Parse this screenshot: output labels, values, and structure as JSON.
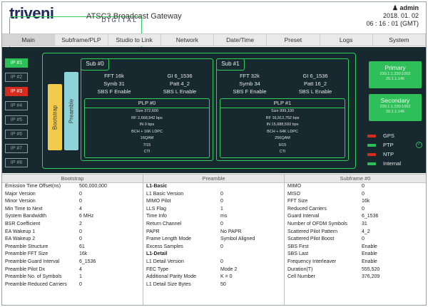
{
  "header": {
    "logo_word": "triveni",
    "logo_sub": "DIGITAL",
    "title": "ATSC3 Broadcast Gateway",
    "user": "admin",
    "date": "2018. 01. 02",
    "time": "06 : 16 : 01 (GMT)"
  },
  "nav": [
    "Main",
    "Subframe/PLP",
    "Studio to Link",
    "Network",
    "Date/Time",
    "Preset",
    "Logs",
    "System"
  ],
  "ip_inputs": [
    "IP #1",
    "IP #2",
    "IP #3",
    "IP #4",
    "IP #5",
    "IP #6",
    "IP #7",
    "IP #8"
  ],
  "ip_states": [
    "green",
    "grey",
    "red",
    "grey",
    "grey",
    "grey",
    "grey",
    "grey"
  ],
  "bars": {
    "bootstrap": "Bootstrap",
    "preamble": "Preamble"
  },
  "subframes": [
    {
      "label": "Sub #0",
      "fft": "FFT 16k",
      "gi": "GI 6_1536",
      "symb": "Symb 31",
      "patt": "Patt 4_2",
      "sbs": "SBS F Enable",
      "sbs2": "SBS L Enable",
      "plp": {
        "label": "PLP #0",
        "lines": [
          "Size 372,600",
          "RF 2,668,942 bps",
          "IN 0 bps",
          "BCH + 16K LDPC",
          "16QAM",
          "7/15",
          "CTI"
        ]
      }
    },
    {
      "label": "Sub #1",
      "fft": "FFT 32k",
      "gi": "GI 6_1536",
      "symb": "Symb 34",
      "patt": "Patt 16_2",
      "sbs": "SBS F Enable",
      "sbs2": "SBS L Enable",
      "plp": {
        "label": "PLP #1",
        "lines": [
          "Size 999,100",
          "RF 16,912,752 bps",
          "IN 15,688,593 bps",
          "BCH + 64K LDPC",
          "256QAM",
          "9/15",
          "CTI"
        ]
      }
    }
  ],
  "outputs": [
    {
      "title": "Primary",
      "addr1": "239.1.1.230:1002",
      "addr2": "20.1.1.146"
    },
    {
      "title": "Secondary",
      "addr1": "239.1.1.230:1002",
      "addr2": "20.1.1.146"
    }
  ],
  "status": [
    {
      "label": "GPS",
      "color": "#d42d20"
    },
    {
      "label": "PTP",
      "color": "#2fbf59"
    },
    {
      "label": "NTP",
      "color": "#d42d20"
    },
    {
      "label": "Internal",
      "color": "#2fbf59"
    }
  ],
  "tables": {
    "bootstrap": {
      "title": "Bootstrap",
      "rows": [
        [
          "Emission Time Offset(ns)",
          "500,000,000"
        ],
        [
          "Major Version",
          "0"
        ],
        [
          "Minor Version",
          "0"
        ],
        [
          "Min Time to Next",
          "4"
        ],
        [
          "System Bandwidth",
          "6 MHz"
        ],
        [
          "BSR Coefficient",
          "2"
        ],
        [
          "EA Wakeup 1",
          "0"
        ],
        [
          "EA Wakeup 2",
          "0"
        ],
        [
          "Preamble Structure",
          "61"
        ],
        [
          "Preamble FFT Size",
          "16k"
        ],
        [
          "Preamble Guard Interval",
          "6_1536"
        ],
        [
          "Preamble Pilot Dx",
          "4"
        ],
        [
          "Preamble No. of Symbols",
          "1"
        ],
        [
          "Preamble Reduced Carriers",
          "0"
        ]
      ]
    },
    "preamble": {
      "title": "Preamble",
      "rows": [
        [
          "L1-Basic",
          "",
          "section"
        ],
        [
          "L1 Basic Version",
          "0"
        ],
        [
          "MIMO Pilot",
          "0"
        ],
        [
          "LLS Flag",
          "1"
        ],
        [
          "Time Info",
          "ms"
        ],
        [
          "Return Channel",
          "0"
        ],
        [
          "PAPR",
          "No PAPR"
        ],
        [
          "Frame Length Mode",
          "Symbol Aligned"
        ],
        [
          "Excess Samples",
          "0"
        ],
        [
          "L1-Detail",
          "",
          "section"
        ],
        [
          "L1 Detail Version",
          "0"
        ],
        [
          "FEC Type",
          "Mode 2"
        ],
        [
          "Additional Parity Mode",
          "K = 0"
        ],
        [
          "L1 Detail Size Bytes",
          "50"
        ]
      ]
    },
    "subframe": {
      "title": "Subframe #0",
      "rows": [
        [
          "MIMO",
          "0"
        ],
        [
          "MISO",
          "0"
        ],
        [
          "FFT Size",
          "16k"
        ],
        [
          "Reduced Carriers",
          "0"
        ],
        [
          "Guard Interval",
          "6_1536"
        ],
        [
          "Number of OFDM Symbols",
          "31"
        ],
        [
          "Scattered Pilot Pattern",
          "4_2"
        ],
        [
          "Scattered Pilot Boost",
          "0"
        ],
        [
          "SBS First",
          "Enable"
        ],
        [
          "SBS Last",
          "Enable"
        ],
        [
          "Frequency Interleaver",
          "Enable"
        ],
        [
          "Duration(T)",
          "555,520"
        ],
        [
          "Cell Number",
          "376,209"
        ]
      ]
    }
  }
}
